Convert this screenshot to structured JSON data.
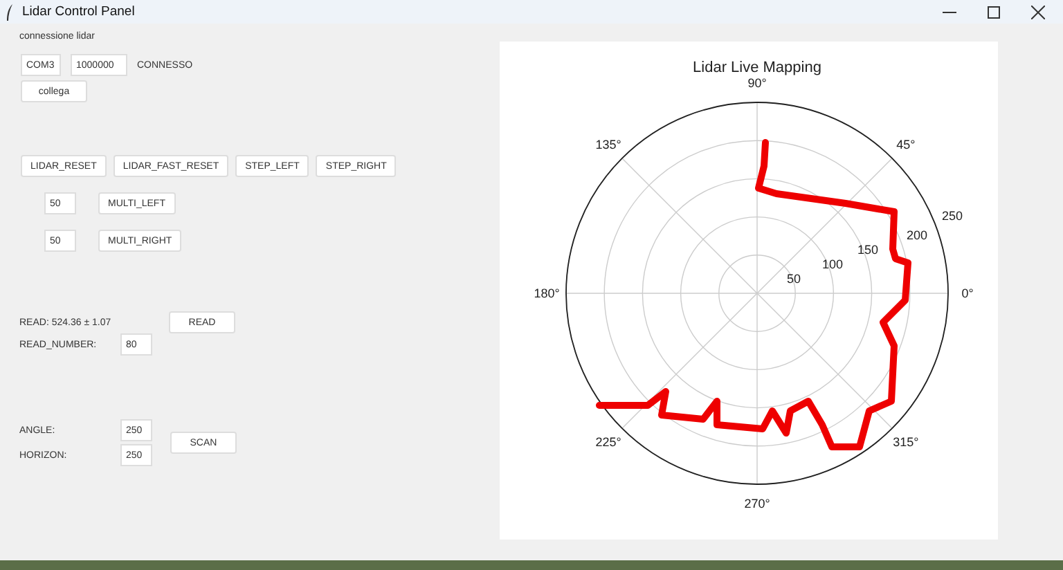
{
  "window": {
    "title": "Lidar Control Panel"
  },
  "connection": {
    "label": "connessione lidar",
    "port": "COM3",
    "baud": "1000000",
    "status": "CONNESSO",
    "button": "collega"
  },
  "commands": [
    "LIDAR_RESET",
    "LIDAR_FAST_RESET",
    "STEP_LEFT",
    "STEP_RIGHT"
  ],
  "multi": [
    {
      "value": "50",
      "button": "MULTI_LEFT"
    },
    {
      "value": "50",
      "button": "MULTI_RIGHT"
    }
  ],
  "read": {
    "result": "READ: 524.36 ± 1.07",
    "button": "READ",
    "number_label": "READ_NUMBER:",
    "number": "80"
  },
  "scan": {
    "angle_label": "ANGLE:",
    "angle": "250",
    "horizon_label": "HORIZON:",
    "horizon": "250",
    "button": "SCAN"
  },
  "chart": {
    "title": "Lidar Live Mapping",
    "angle_labels": [
      "0°",
      "45°",
      "90°",
      "135°",
      "180°",
      "225°",
      "270°",
      "315°"
    ],
    "radial_labels": [
      "50",
      "100",
      "150",
      "200",
      "250"
    ]
  }
}
